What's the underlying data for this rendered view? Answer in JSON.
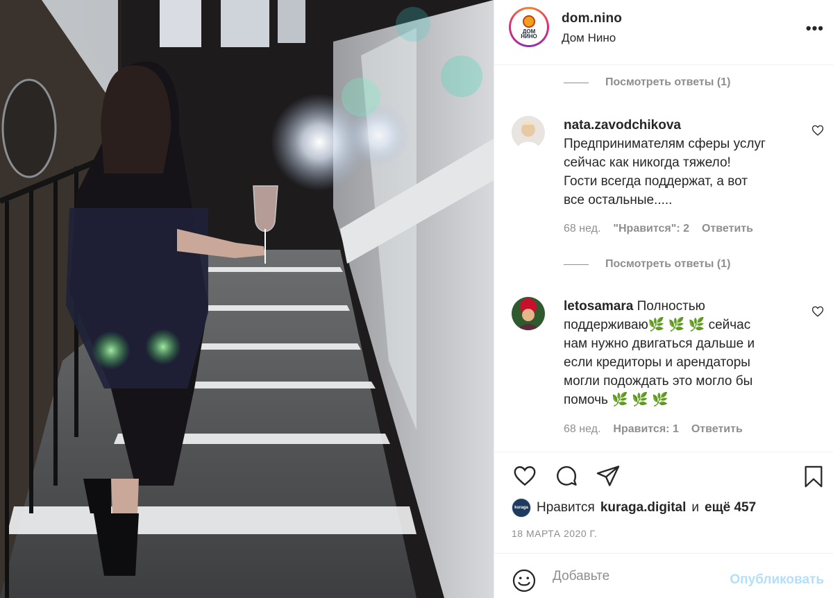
{
  "post": {
    "username": "dom.nino",
    "full_name": "Дом Нино",
    "more_label": "•••",
    "logo_text_line1": "ДОМ",
    "logo_text_line2": "НИНО"
  },
  "comments": [
    {
      "view_replies": "Посмотреть ответы (1)"
    },
    {
      "username": "nata.zavodchikova",
      "lines": [
        "Предпринимателям сферы услуг",
        "сейчас как никогда тяжело!",
        "Гости всегда поддержат, а вот",
        "все остальные....."
      ],
      "age": "68 нед.",
      "likes_label": "\"Нравится\": 2",
      "reply_label": "Ответить",
      "view_replies": "Посмотреть ответы (1)"
    },
    {
      "username": "letosamara",
      "first_line_rest": " Полностью",
      "lines": [
        "поддерживаю🌿 🌿 🌿  сейчас",
        "нам нужно двигаться дальше и",
        "если кредиторы и арендаторы",
        "могли подождать это могло бы",
        "помочь 🌿 🌿 🌿"
      ],
      "age": "68 нед.",
      "likes_label": "Нравится: 1",
      "reply_label": "Ответить"
    }
  ],
  "likes": {
    "prefix": "Нравится",
    "user": "kuraga.digital",
    "conj": "и",
    "others": "ещё 457",
    "avatar_text": "kuraga"
  },
  "date": "18 МАРТА 2020 Г.",
  "composer": {
    "placeholder": "Добавьте",
    "publish_label": "Опубликовать"
  },
  "icons": [
    "more-icon",
    "heart-icon",
    "comment-icon",
    "share-icon",
    "bookmark-icon",
    "smile-icon"
  ],
  "colors": {
    "text": "#262626",
    "muted": "#8e8e8e",
    "border": "#efefef",
    "publish_disabled": "#b2dffc"
  }
}
